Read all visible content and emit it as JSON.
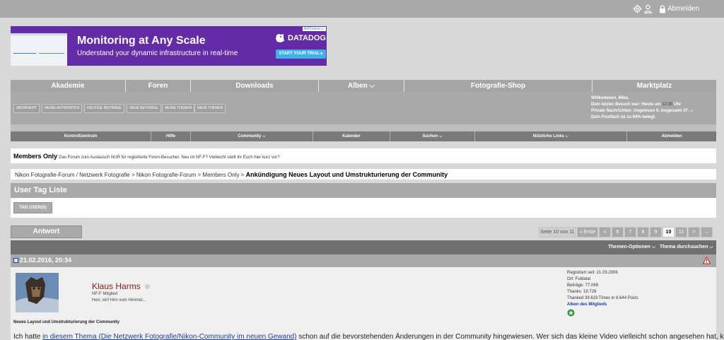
{
  "topbar": {
    "settings_icon": "gear-icon",
    "profile_icon": "user-icon",
    "lock_icon": "lock-icon",
    "logout_label": "Abmelden"
  },
  "ad": {
    "title": "Monitoring at Any Scale",
    "subtitle": "Understand your dynamic infrastructure in real-time",
    "brand": "DATADOG",
    "cta": "START YOUR TRIAL ▸",
    "adchoices": "AdChoices ▷",
    "colors": {
      "background": "#632ca6",
      "cta": "#3fb0e8"
    }
  },
  "nav": [
    {
      "label": "Akademie"
    },
    {
      "label": "Foren"
    },
    {
      "label": "Downloads"
    },
    {
      "label": "Alben",
      "has_dropdown": true
    },
    {
      "label": "Fotografie-Shop"
    },
    {
      "label": "Marktplatz"
    }
  ],
  "quicklinks": [
    "ABONNIERT",
    "MEINE ANTWORTEN",
    "HEUTIGE BEITRÄGE",
    "NEUE BEITRÄGE",
    "MEINE THEMEN",
    "NEUE THEMEN"
  ],
  "welcome": {
    "line1": "Willkommen, Mika.",
    "line2_prefix": "Dein letzter Besuch war: Heute um ",
    "line2_time": "12:30",
    "line2_suffix": " Uhr",
    "line3": "Private Nachrichten: Ungelesen 0, insgesamt 47.",
    "line4": "Dein Postfach ist zu 94% belegt."
  },
  "control_bar": [
    {
      "label": "Kontrollzentrum"
    },
    {
      "label": "Hilfe"
    },
    {
      "label": "Community",
      "has_dropdown": true
    },
    {
      "label": "Kalender"
    },
    {
      "label": "Suchen",
      "has_dropdown": true
    },
    {
      "label": "Nützliche Links",
      "has_dropdown": true
    },
    {
      "label": "Abmelden"
    }
  ],
  "forum_notice": {
    "title": "Members Only",
    "description": "Das Forum zum Austausch NUR für registrierte Foren-Besucher. Neu im NF-F? Vielleicht stellt Ihr Euch hier kurz vor?"
  },
  "breadcrumb": {
    "path": "Nikon Fotografie-Forum / Netzwerk Fotografie > Nikon Fotografie-Forum > Members Only >",
    "current": "Ankündigung Neues Layout und Umstrukturierung der Community"
  },
  "user_tag": {
    "title": "User Tag Liste",
    "button": "TAG USER(S)"
  },
  "reply_button": "Antwort",
  "pagination": {
    "info": "Seite 10 von 11",
    "first": "« Erste",
    "prev": "<",
    "pages": [
      "6",
      "7",
      "8",
      "9",
      "10",
      "11"
    ],
    "current_page": "10",
    "next": ">"
  },
  "thread_options": {
    "themen_optionen": "Themen-Optionen",
    "thema_durchsuchen": "Thema durchsuchen"
  },
  "post": {
    "date": "21.02.2016, 20:34",
    "author": {
      "name": "Klaus Harms",
      "title": "NF-F Mitglied",
      "slogan": "Herr, wirf Hirn vom Himmel..."
    },
    "info": {
      "registered": "Registriert seit: 21.03.2006",
      "location": "Ort: Fuldatal",
      "posts": "Beiträge: 77.069",
      "thanks": "Thanks: 19.729",
      "thanked": "Thanked 39.623 Times in 8.644 Posts",
      "albums": "Alben des Mitglieds"
    },
    "title": "Neues Layout und Umstrukturierung der Community",
    "text_prefix": "Ich hatte ",
    "text_link": "in diesem Thema (Die Netzwerk Fotografie/Nikon-Community im neuen Gewand)",
    "text_suffix": " schon auf die bevorstehenden Änderungen in der Community hingewiesen. Wer sich das kleine Video vielleicht schon angesehen hat, kann"
  }
}
